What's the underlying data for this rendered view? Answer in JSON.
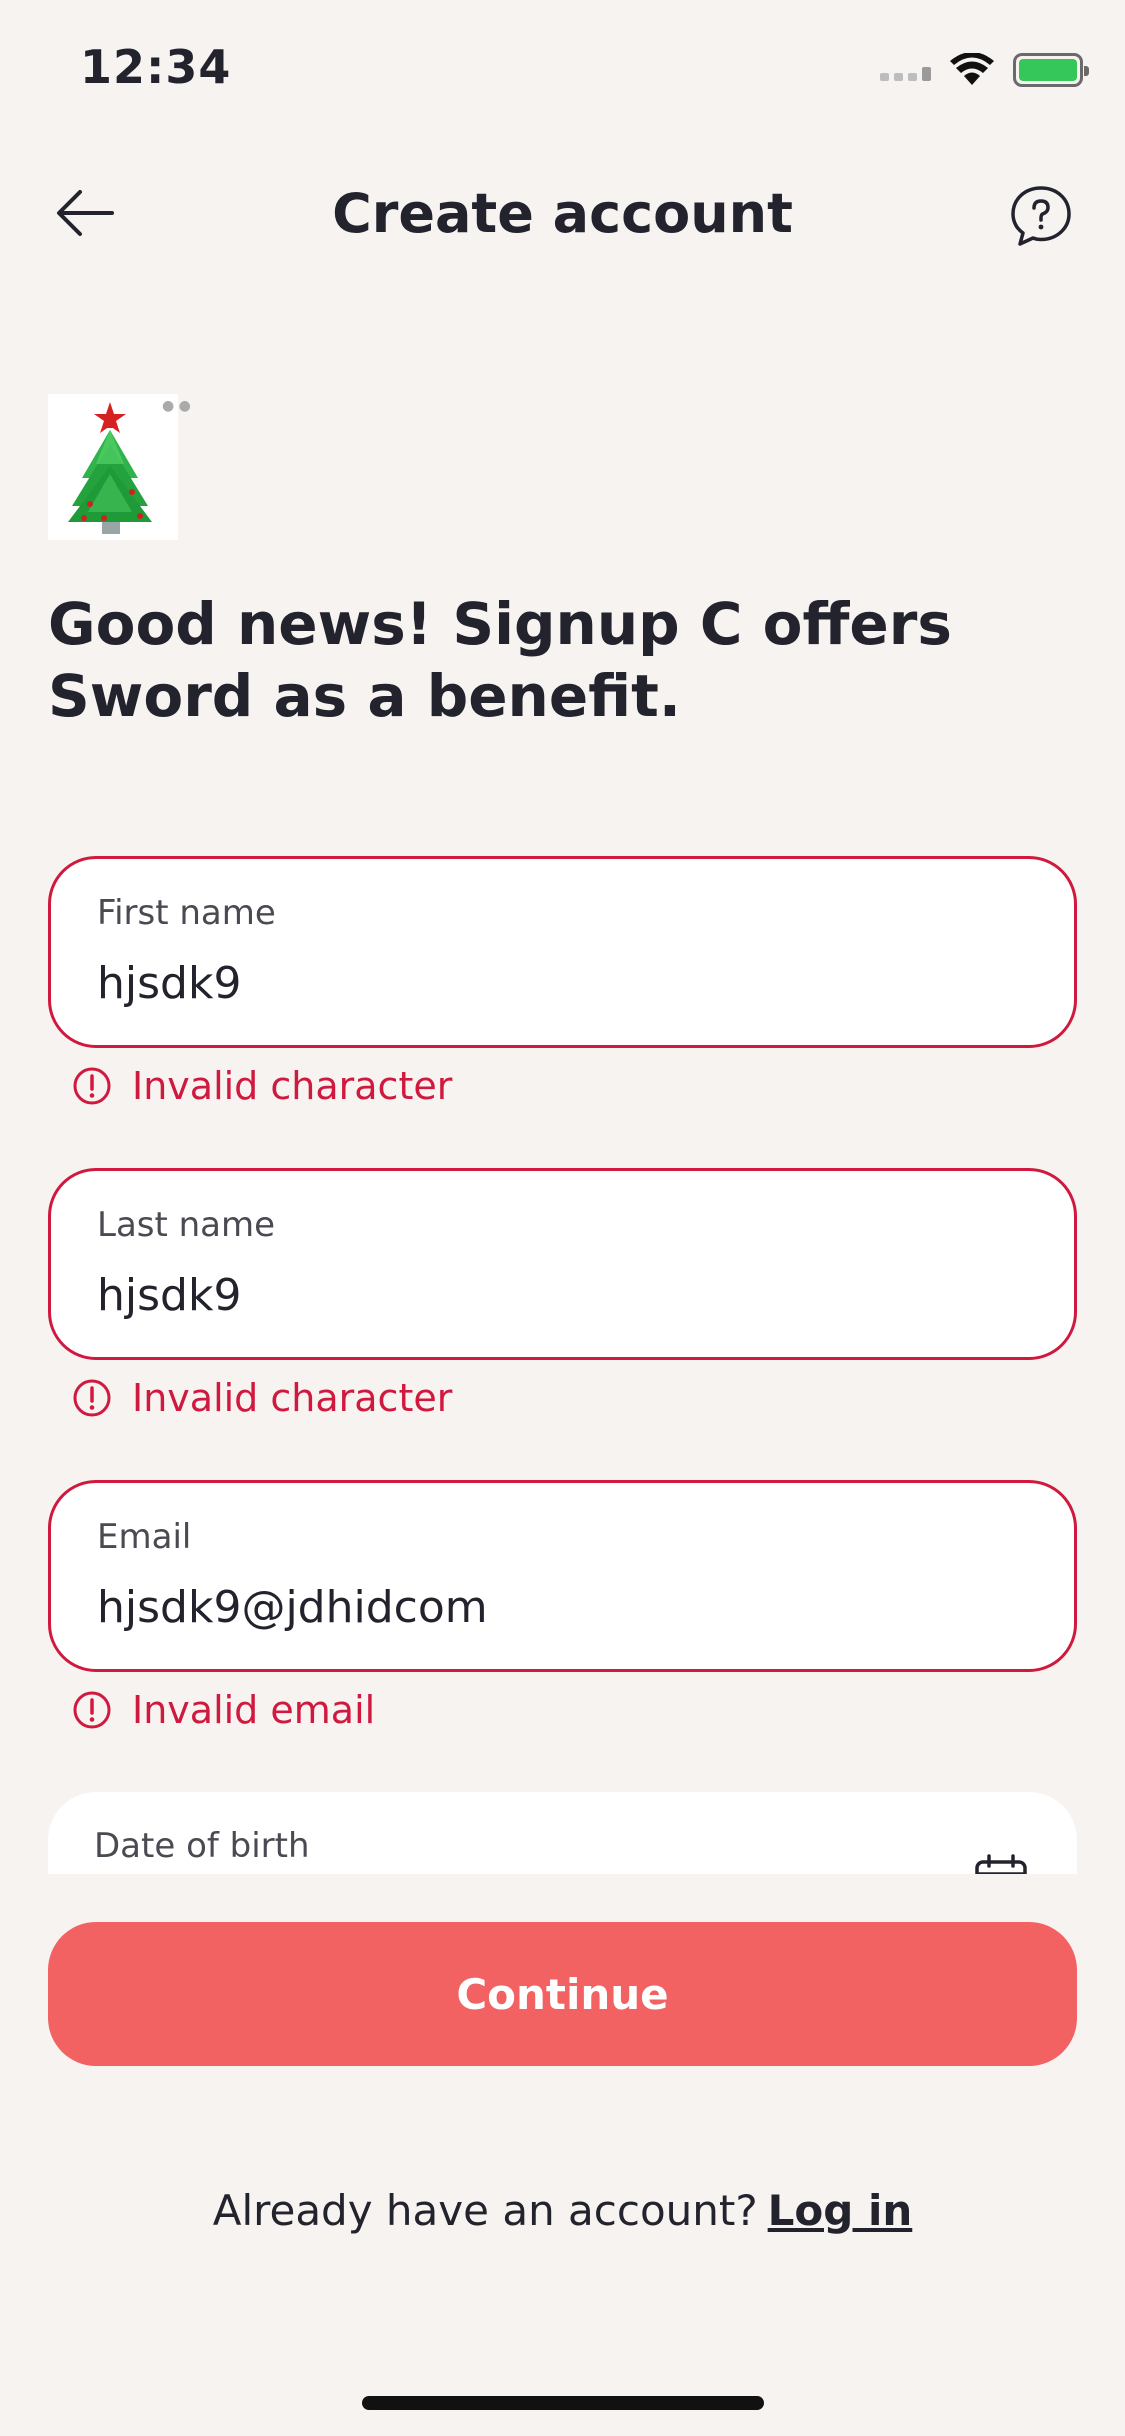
{
  "status_bar": {
    "time": "12:34"
  },
  "nav": {
    "title": "Create account"
  },
  "headline": "Good news! Signup C offers Sword as a benefit.",
  "form": {
    "first_name": {
      "label": "First name",
      "value": "hjsdk9",
      "error": "Invalid character"
    },
    "last_name": {
      "label": "Last name",
      "value": "hjsdk9",
      "error": "Invalid character"
    },
    "email": {
      "label": "Email",
      "value": "hjsdk9@jdhidcom",
      "error": "Invalid email"
    },
    "dob": {
      "label": "Date of birth"
    }
  },
  "continue_label": "Continue",
  "login": {
    "prompt": "Already have an account?",
    "link": "Log in"
  },
  "colors": {
    "error": "#d0193f",
    "button": "#f26262",
    "background": "#f7f3f1"
  }
}
